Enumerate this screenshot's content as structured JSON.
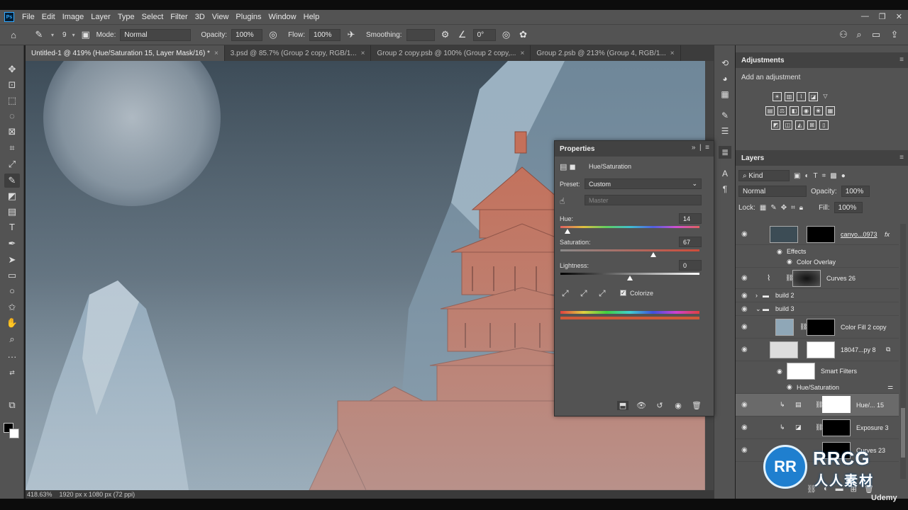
{
  "menu": {
    "app_icon": "Ps",
    "items": [
      "File",
      "Edit",
      "Image",
      "Layer",
      "Type",
      "Select",
      "Filter",
      "3D",
      "View",
      "Plugins",
      "Window",
      "Help"
    ]
  },
  "options": {
    "brush_size": "9",
    "mode_label": "Mode:",
    "mode_value": "Normal",
    "opacity_label": "Opacity:",
    "opacity_value": "100%",
    "flow_label": "Flow:",
    "flow_value": "100%",
    "smoothing_label": "Smoothing:",
    "angle_value": "0°"
  },
  "tabs": [
    {
      "label": "Untitled-1 @ 419% (Hue/Saturation 15, Layer Mask/16) *"
    },
    {
      "label": "3.psd @ 85.7% (Group 2 copy, RGB/1..."
    },
    {
      "label": "Group 2 copy.psb @ 100% (Group 2 copy,..."
    },
    {
      "label": "Group 2.psb @ 213% (Group 4, RGB/1..."
    }
  ],
  "status": {
    "zoom": "418.63%",
    "doc_size": "1920 px x 1080 px (72 ppi)"
  },
  "adjustments": {
    "title": "Adjustments",
    "subtitle": "Add an adjustment"
  },
  "properties": {
    "title": "Properties",
    "adj_name": "Hue/Saturation",
    "preset_label": "Preset:",
    "preset_value": "Custom",
    "channel_value": "Master",
    "hue_label": "Hue:",
    "hue_value": "14",
    "saturation_label": "Saturation:",
    "saturation_value": "67",
    "lightness_label": "Lightness:",
    "lightness_value": "0",
    "colorize_label": "Colorize",
    "hue_slider": 0.05,
    "saturation_slider": 0.67,
    "lightness_slider": 0.5
  },
  "layers": {
    "title": "Layers",
    "kind": "Kind",
    "blend": "Normal",
    "opacity_label": "Opacity:",
    "opacity_value": "100%",
    "lock_label": "Lock:",
    "fill_label": "Fill:",
    "fill_value": "100%",
    "rows": [
      {
        "name": "canyo...0973",
        "fx": "fx"
      },
      {
        "name": "Effects"
      },
      {
        "name": "Color Overlay"
      },
      {
        "name": "Curves 26"
      },
      {
        "name": "build 2"
      },
      {
        "name": "build 3"
      },
      {
        "name": "Color Fill 2 copy"
      },
      {
        "name": "18047...py 8"
      },
      {
        "name": "Smart Filters"
      },
      {
        "name": "Hue/Saturation"
      },
      {
        "name": "Hue/... 15"
      },
      {
        "name": "Exposure 3"
      },
      {
        "name": "Curves 23"
      }
    ]
  },
  "watermark": {
    "logo": "RR",
    "line1": "RRCG",
    "line2": "人人素材",
    "udemy": "Udemy"
  }
}
